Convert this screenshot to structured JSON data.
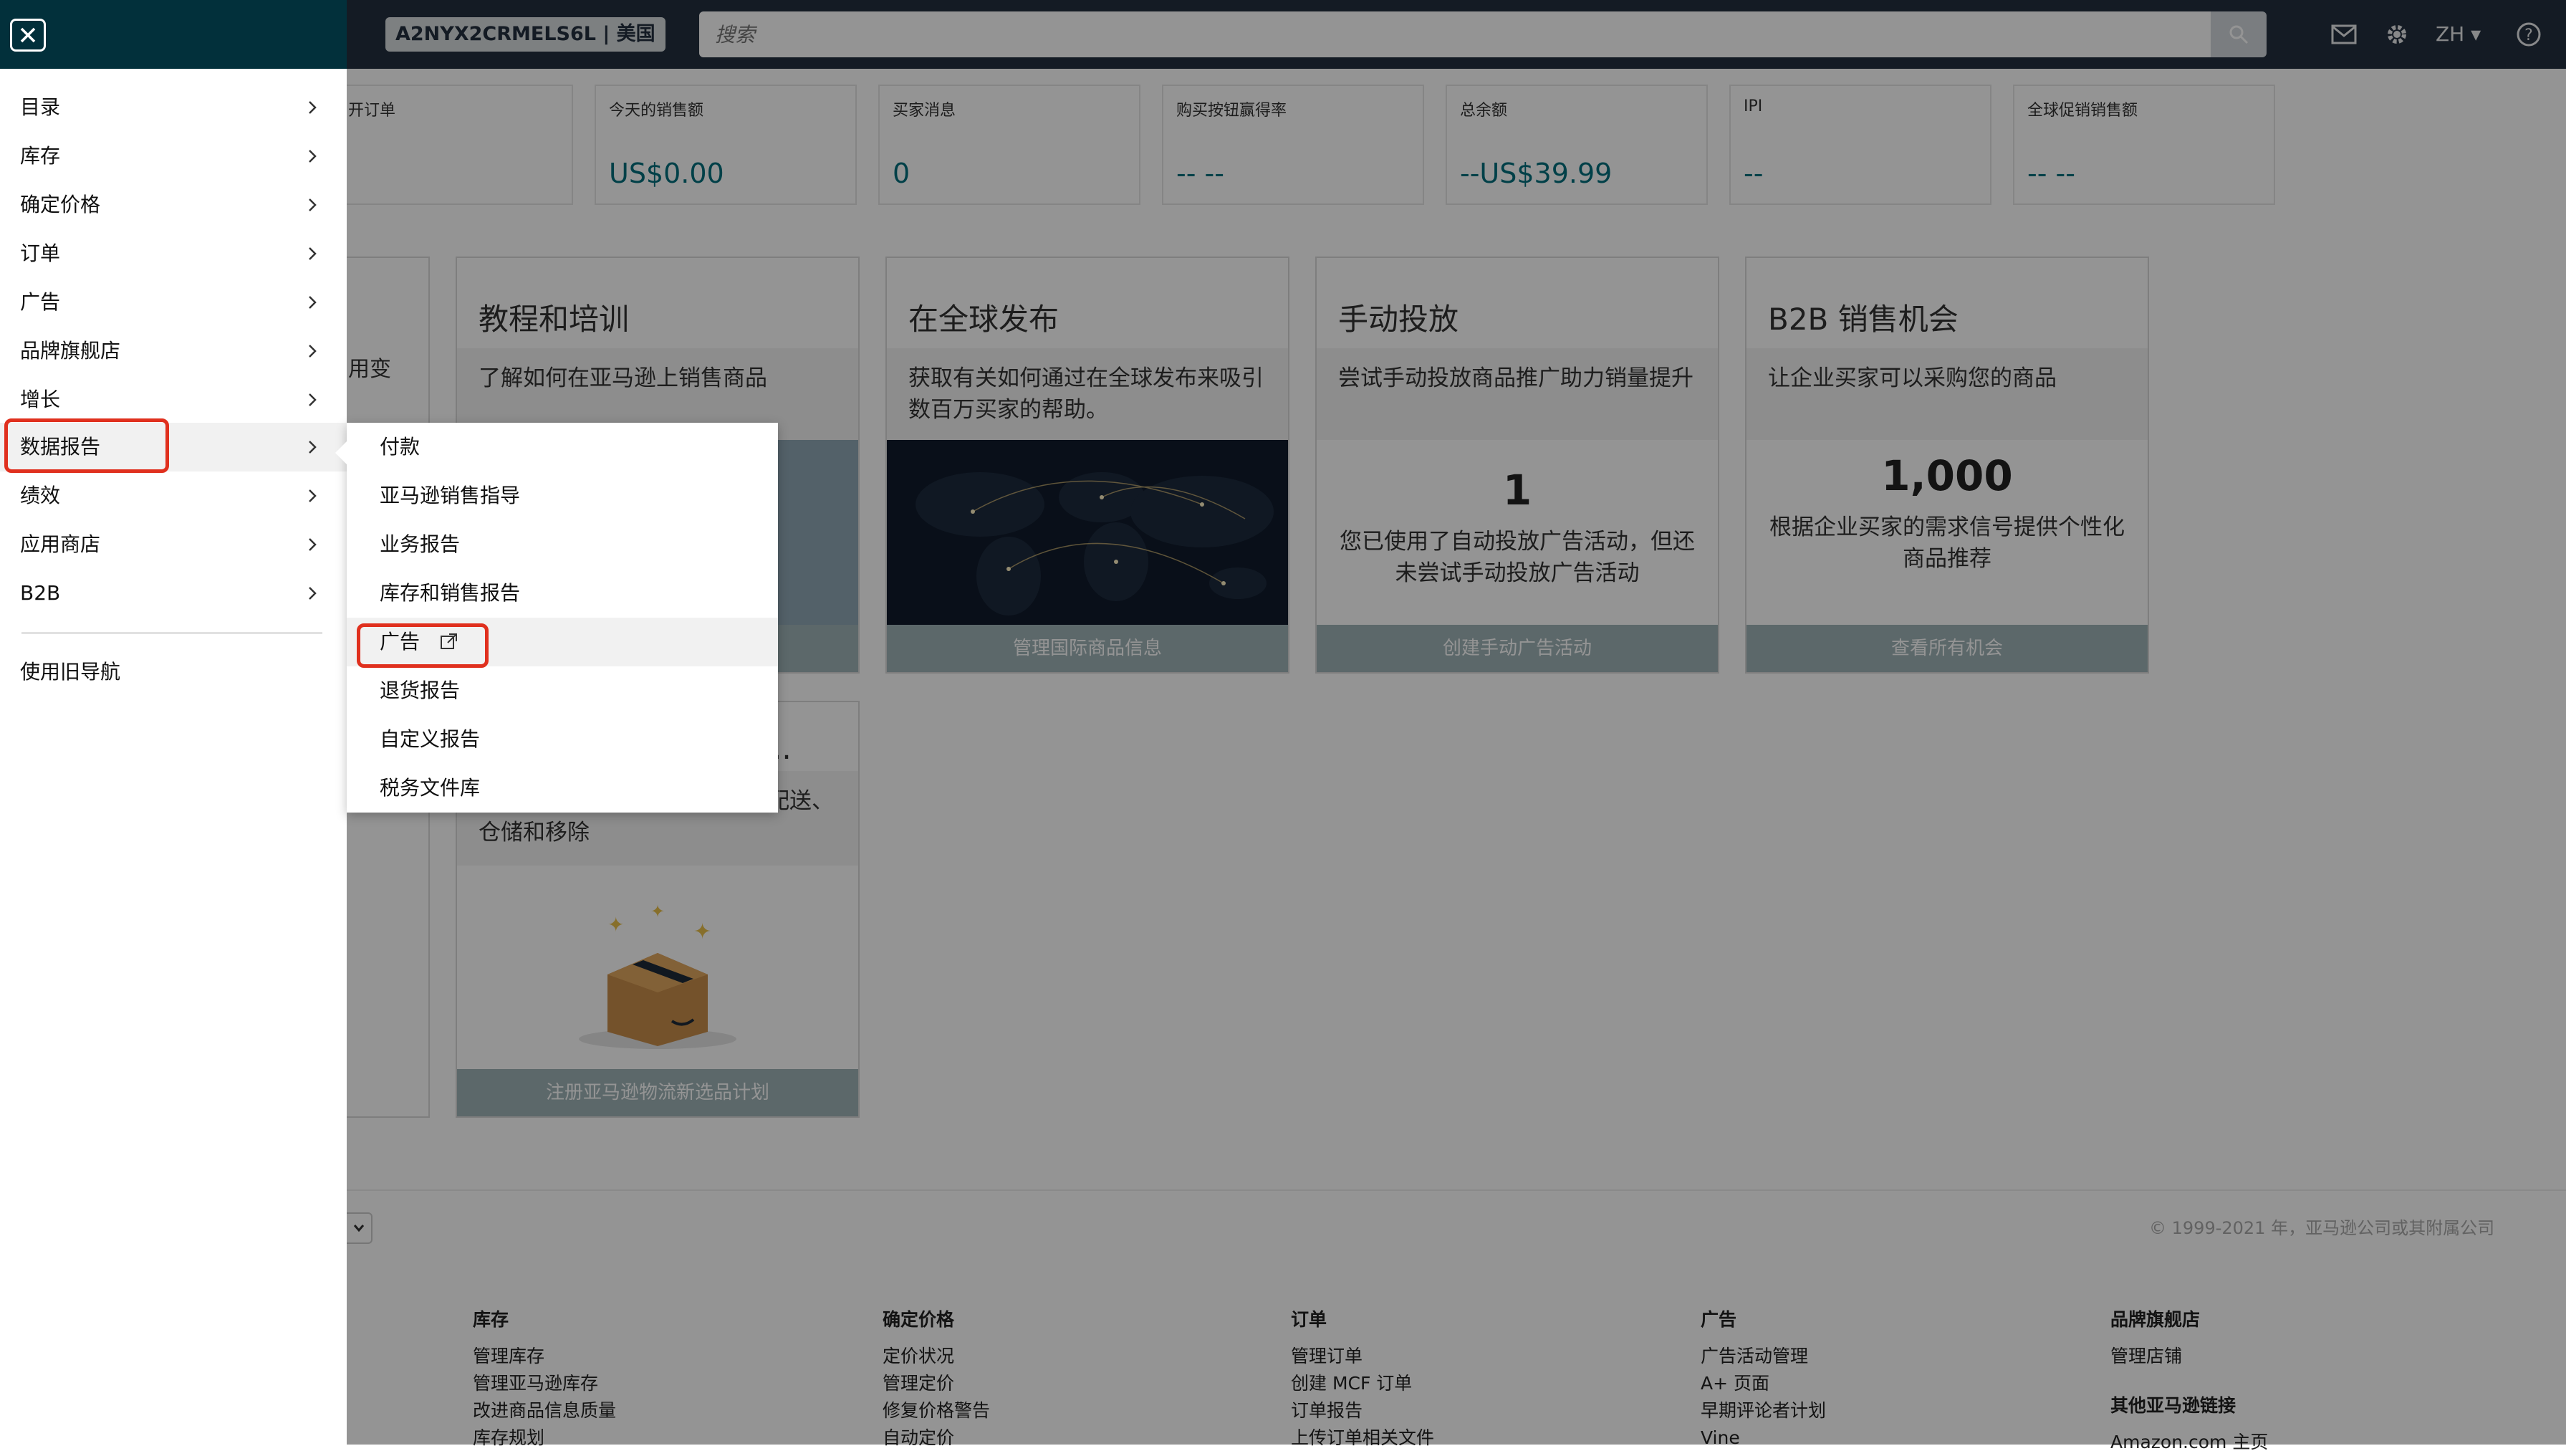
{
  "header": {
    "account_badge": "A2NYX2CRMELS6L | 美国",
    "search_placeholder": "搜索",
    "language": "ZH",
    "icons": [
      "mail-icon",
      "gear-icon",
      "help-icon",
      "search-icon"
    ]
  },
  "metrics": [
    {
      "label": "开订单",
      "value": ""
    },
    {
      "label": "今天的销售额",
      "value": "US$0.00"
    },
    {
      "label": "买家消息",
      "value": "0"
    },
    {
      "label": "购买按钮赢得率",
      "value": "-- --"
    },
    {
      "label": "总余额",
      "value": "--US$39.99"
    },
    {
      "label": "IPI",
      "value": "--"
    },
    {
      "label": "全球促销销售额",
      "value": "-- --"
    }
  ],
  "cards": {
    "partial_text": "用变",
    "tutorial": {
      "title": "教程和培训",
      "subtitle": "了解如何在亚马逊上销售商品"
    },
    "global": {
      "title": "在全球发布",
      "subtitle": "获取有关如何通过在全球发布来吸引数百万买家的帮助。",
      "button": "管理国际商品信息"
    },
    "manual_ads": {
      "title": "手动投放",
      "subtitle": "尝试手动投放商品推广助力销量提升",
      "big_number": "1",
      "desc": "您已使用了自动投放广告活动，但还未尝试手动投放广告活动",
      "button": "创建手动广告活动"
    },
    "b2b": {
      "title": "B2B 销售机会",
      "subtitle": "让企业买家可以采购您的商品",
      "big_number": "1,000",
      "desc": "根据企业买家的需求信号提供个性化商品推荐",
      "button": "查看所有机会"
    },
    "fba": {
      "title_partial": "..",
      "subtitle": "亚马逊物流选品享受免费入库配送、仓储和移除",
      "button": "注册亚马逊物流新选品计划"
    }
  },
  "footer": {
    "copyright": "© 1999-2021 年，亚马逊公司或其附属公司",
    "columns": [
      {
        "heading": "库存",
        "links": [
          "管理库存",
          "管理亚马逊库存",
          "改进商品信息质量",
          "库存规划"
        ]
      },
      {
        "heading": "确定价格",
        "links": [
          "定价状况",
          "管理定价",
          "修复价格警告",
          "自动定价"
        ]
      },
      {
        "heading": "订单",
        "links": [
          "管理订单",
          "创建 MCF 订单",
          "订单报告",
          "上传订单相关文件"
        ]
      },
      {
        "heading": "广告",
        "links": [
          "广告活动管理",
          "A+ 页面",
          "早期评论者计划",
          "Vine"
        ]
      },
      {
        "heading": "品牌旗舰店",
        "links": [
          "管理店铺"
        ],
        "heading2": "其他亚马逊链接",
        "links2": [
          "Amazon.com 主页"
        ]
      }
    ]
  },
  "drawer": {
    "items": [
      {
        "label": "目录"
      },
      {
        "label": "库存"
      },
      {
        "label": "确定价格"
      },
      {
        "label": "订单"
      },
      {
        "label": "广告"
      },
      {
        "label": "品牌旗舰店"
      },
      {
        "label": "增长"
      },
      {
        "label": "数据报告"
      },
      {
        "label": "绩效"
      },
      {
        "label": "应用商店"
      },
      {
        "label": "B2B"
      }
    ],
    "legacy_nav": "使用旧导航",
    "highlight_color": "#e0301e"
  },
  "submenu": {
    "items": [
      {
        "label": "付款"
      },
      {
        "label": "亚马逊销售指导"
      },
      {
        "label": "业务报告"
      },
      {
        "label": "库存和销售报告"
      },
      {
        "label": "广告",
        "external": true
      },
      {
        "label": "退货报告"
      },
      {
        "label": "自定义报告"
      },
      {
        "label": "税务文件库"
      }
    ]
  }
}
